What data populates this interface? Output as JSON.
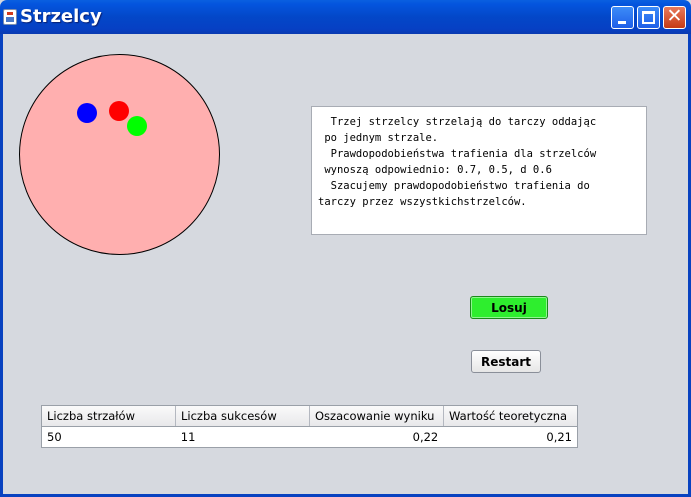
{
  "window": {
    "title": "Strzelcy",
    "controls": [
      "minimize-icon",
      "maximize-icon",
      "close-icon"
    ],
    "close_glyph": "✕"
  },
  "target": {
    "fill_color": "#ffafaf",
    "hits": [
      {
        "name": "blue",
        "color": "#0000ff"
      },
      {
        "name": "red",
        "color": "#ff0000"
      },
      {
        "name": "green",
        "color": "#00ff00"
      }
    ]
  },
  "description": "  Trzej strzelcy strzelają do tarczy oddając\n po jednym strzale.\n  Prawdopodobieństwa trafienia dla strzelców\n wynoszą odpowiednio: 0.7, 0.5, d 0.6\n  Szacujemy prawdopodobieństwo trafienia do\ntarczy przez wszystkichstrzelców.",
  "buttons": {
    "losuj": "Losuj",
    "restart": "Restart"
  },
  "results_table": {
    "headers": [
      "Liczba strzałów",
      "Liczba sukcesów",
      "Oszacowanie wyniku",
      "Wartość teoretyczna"
    ],
    "rows": [
      [
        "50",
        "11",
        "0,22",
        "0,21"
      ]
    ]
  }
}
